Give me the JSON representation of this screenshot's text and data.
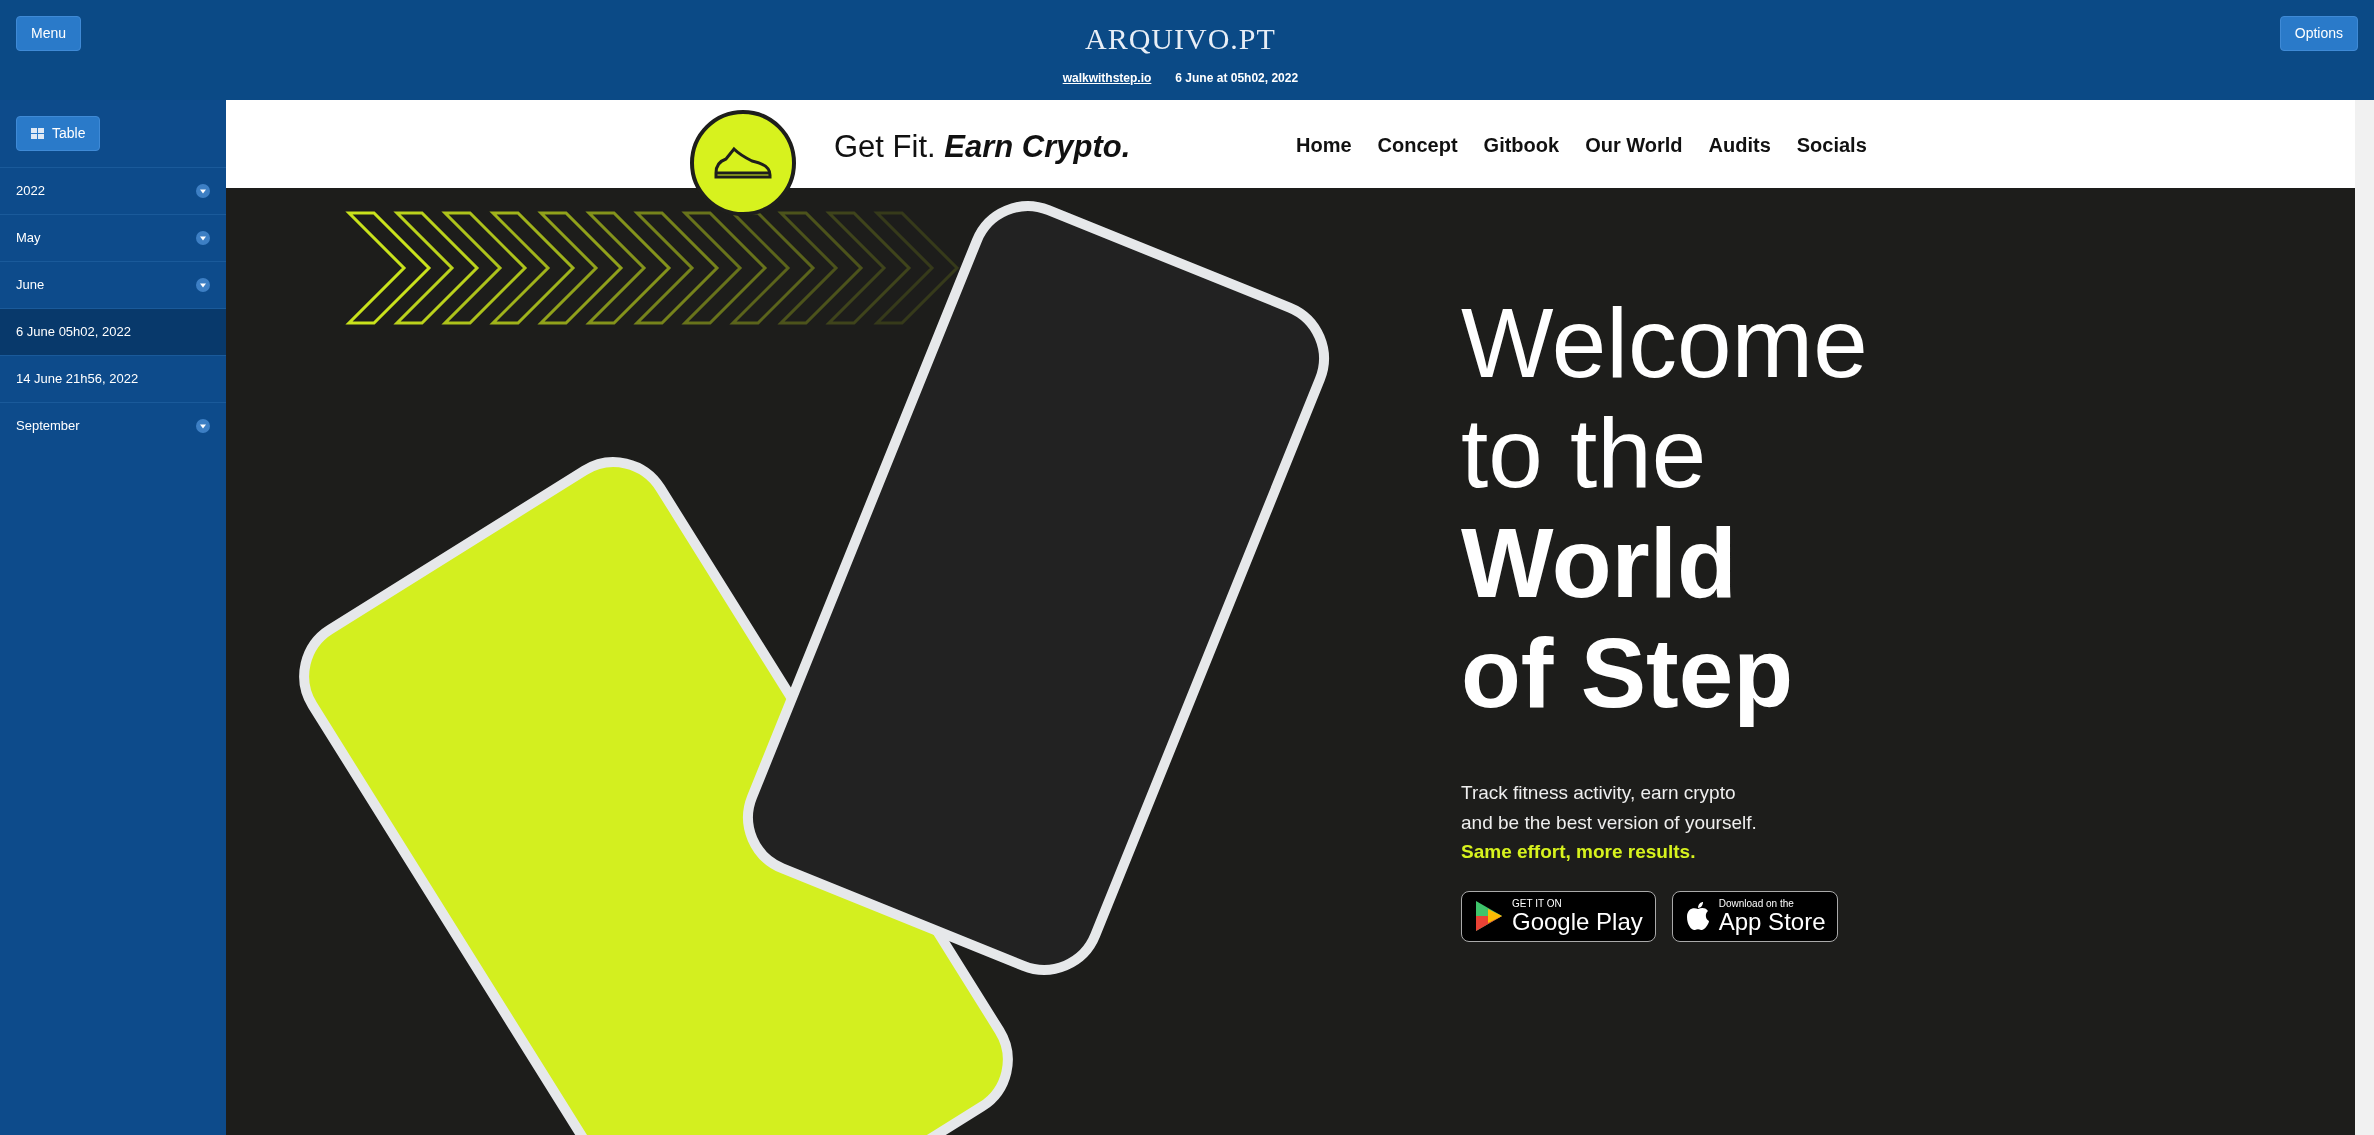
{
  "top_bar": {
    "menu_button": "Menu",
    "logo": "ARQUIVO.PT",
    "site_link": "walkwithstep.io",
    "capture_date": "6 June at 05h02, 2022",
    "options_button": "Options"
  },
  "sidebar": {
    "table_button": "Table",
    "items": [
      {
        "label": "2022",
        "kind": "group",
        "selected": false
      },
      {
        "label": "May",
        "kind": "group",
        "selected": false
      },
      {
        "label": "June",
        "kind": "group",
        "selected": false
      },
      {
        "label": "6 June 05h02, 2022",
        "kind": "capture",
        "selected": true
      },
      {
        "label": "14 June 21h56, 2022",
        "kind": "capture",
        "selected": false
      },
      {
        "label": "September",
        "kind": "group",
        "selected": false
      }
    ]
  },
  "archived_page": {
    "tagline_plain": "Get Fit.",
    "tagline_bold": "Earn Crypto.",
    "nav": [
      "Home",
      "Concept",
      "Gitbook",
      "Our World",
      "Audits",
      "Socials"
    ],
    "hero": {
      "heading_lines": [
        {
          "text": "Welcome",
          "bold": false
        },
        {
          "text": "to the",
          "bold": false
        },
        {
          "text": "World",
          "bold": true
        },
        {
          "text": "of Step",
          "bold": true
        }
      ],
      "description_lines": [
        "Track fitness activity, earn crypto",
        "and be the best version of yourself."
      ],
      "highlight": "Same effort, more results.",
      "store_buttons": [
        {
          "kind": "google",
          "small": "GET IT ON",
          "large": "Google Play"
        },
        {
          "kind": "apple",
          "small": "Download on the",
          "large": "App Store"
        }
      ]
    }
  }
}
